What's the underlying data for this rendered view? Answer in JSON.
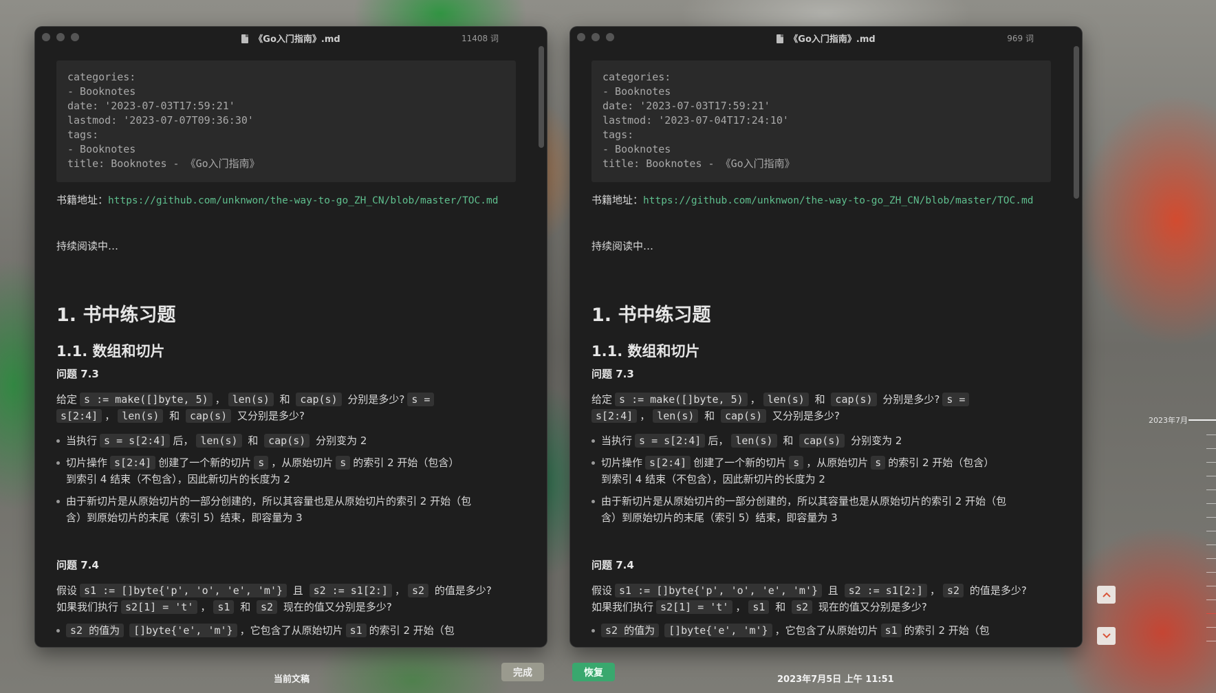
{
  "app": {
    "bottom_left_label": "当前文稿",
    "done_button": "完成",
    "restore_button": "恢复",
    "bottom_right_label": "2023年7月5日 上午 11:51"
  },
  "timeline": {
    "month_label": "2023年7月",
    "up_icon": "chevron-up-icon",
    "down_icon": "chevron-down-icon"
  },
  "left": {
    "title": "《Go入门指南》.md",
    "wordcount": "11408 词",
    "frontmatter": [
      "categories:",
      "- Booknotes",
      "date: '2023-07-03T17:59:21'",
      "lastmod: '2023-07-07T09:36:30'",
      "tags:",
      "- Booknotes",
      "title: Booknotes - 《Go入门指南》"
    ]
  },
  "right": {
    "title": "《Go入门指南》.md",
    "wordcount": "969 词",
    "frontmatter": [
      "categories:",
      "- Booknotes",
      "date: '2023-07-03T17:59:21'",
      "lastmod: '2023-07-04T17:24:10'",
      "tags:",
      "- Booknotes",
      "title: Booknotes - 《Go入门指南》"
    ]
  },
  "doc": {
    "book_label": "书籍地址：",
    "book_url": "https://github.com/unknwon/the-way-to-go_ZH_CN/blob/master/TOC.md",
    "reading": "持续阅读中…",
    "h1": "1. 书中练习题",
    "h2": "1.1. 数组和切片",
    "q73": "问题 7.3",
    "q73_t1": "给定",
    "q73_c1": "s := make([]byte, 5)",
    "q73_t2": "，",
    "q73_c2": "len(s)",
    "q73_t3": "和",
    "q73_c3": "cap(s)",
    "q73_t4": "分别是多少?",
    "q73_c4a": "s =",
    "q73_c4b": "s[2:4]",
    "q73_t5": "，",
    "q73_c5": "len(s)",
    "q73_t6": "和",
    "q73_c6": "cap(s)",
    "q73_t7": "又分别是多少?",
    "b1_t1": "当执行",
    "b1_c1": "s = s[2:4]",
    "b1_t2": "后，",
    "b1_c2": "len(s)",
    "b1_t3": "和",
    "b1_c3": "cap(s)",
    "b1_t4": "分别变为 2",
    "b2_t1": "切片操作",
    "b2_c1": "s[2:4]",
    "b2_t2": "创建了一个新的切片",
    "b2_c2": "s",
    "b2_t3": "，从原始切片",
    "b2_c3": "s",
    "b2_t4": "的索引 2 开始（包含）",
    "b2_l2": "到索引 4 结束（不包含），因此新切片的长度为 2",
    "b3_l1": "由于新切片是从原始切片的一部分创建的，所以其容量也是从原始切片的索引 2 开始（包",
    "b3_l2": "含）到原始切片的末尾（索引 5）结束，即容量为 3",
    "q74": "问题 7.4",
    "q74_t1": "假设",
    "q74_c1": "s1 := []byte{'p', 'o', 'e', 'm'}",
    "q74_t2": "且",
    "q74_c2": "s2 := s1[2:]",
    "q74_t3": "，",
    "q74_c3": "s2",
    "q74_t4": "的值是多少?",
    "q74_t5": "如果我们执行",
    "q74_c5": "s2[1] = 't'",
    "q74_t6": "，",
    "q74_c6": "s1",
    "q74_t7": "和",
    "q74_c7": "s2",
    "q74_t8": "现在的值又分别是多少?",
    "b4_t1": "s2 的值为",
    "b4_c1": "[]byte{'e', 'm'}",
    "b4_t2": "，它包含了从原始切片",
    "b4_c2": "s1",
    "b4_t3": "的索引 2 开始（包"
  }
}
